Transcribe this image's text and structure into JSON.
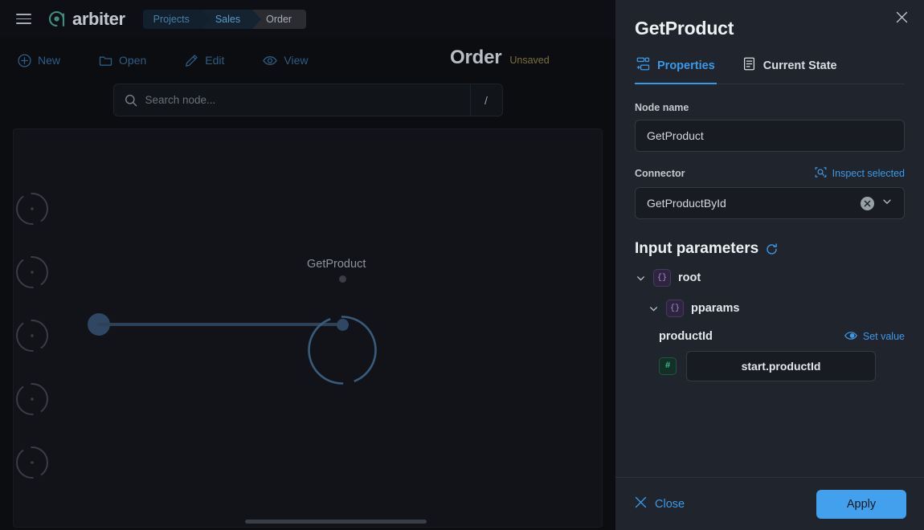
{
  "topbar": {
    "menu_icon": "hamburger-icon",
    "logo_text": "arbiter",
    "logo_icon": "arbiter-logo-mark",
    "breadcrumb": [
      {
        "label": "Projects"
      },
      {
        "label": "Sales"
      },
      {
        "label": "Order"
      }
    ]
  },
  "toolbar": {
    "items": [
      {
        "label": "New",
        "icon": "plus-circle-icon"
      },
      {
        "label": "Open",
        "icon": "folder-icon"
      },
      {
        "label": "Edit",
        "icon": "pencil-icon"
      },
      {
        "label": "View",
        "icon": "eye-icon"
      }
    ]
  },
  "document": {
    "title": "Order",
    "status": "Unsaved"
  },
  "search": {
    "placeholder": "Search node...",
    "value": "",
    "shortcut": "/",
    "icon": "search-icon"
  },
  "canvas": {
    "node_label": "GetProduct",
    "ghost_nodes": 5
  },
  "panel": {
    "title": "GetProduct",
    "close_icon": "close-icon",
    "tabs": [
      {
        "label": "Properties",
        "icon": "properties-icon",
        "active": true
      },
      {
        "label": "Current State",
        "icon": "document-list-icon",
        "active": false
      }
    ],
    "node_name": {
      "label": "Node name",
      "value": "GetProduct"
    },
    "connector": {
      "label": "Connector",
      "inspect_label": "Inspect selected",
      "inspect_icon": "inspect-icon",
      "value": "GetProductById",
      "clear_icon": "clear-icon",
      "chevron_icon": "chevron-down-icon"
    },
    "input_parameters": {
      "title": "Input parameters",
      "refresh_icon": "refresh-icon",
      "tree": [
        {
          "name": "root",
          "badge": "{}",
          "level": 1,
          "expanded": true
        },
        {
          "name": "pparams",
          "badge": "{}",
          "level": 2,
          "expanded": true
        }
      ],
      "param": {
        "name": "productId",
        "set_value_label": "Set value",
        "set_value_icon": "eye-toggle-icon",
        "type_badge": "#",
        "value": "start.productId"
      }
    },
    "footer": {
      "close_label": "Close",
      "close_icon": "close-x-icon",
      "apply_label": "Apply"
    }
  },
  "colors": {
    "accent_blue": "#3b9ae8",
    "apply_blue": "#42a0ec",
    "logo_teal": "#3f8f7e",
    "unsaved_olive": "#7d6f3c",
    "panel_bg": "#20242c",
    "canvas_bg": "#111318",
    "node_blue": "#2f4763",
    "badge_purple": "#a98fd8",
    "badge_green": "#3fbf8f"
  }
}
